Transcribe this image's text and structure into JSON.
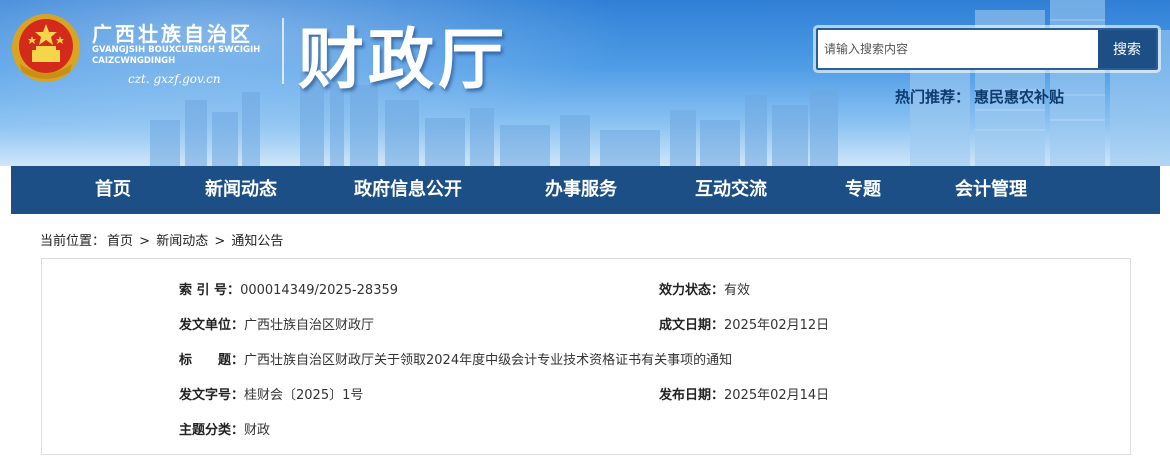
{
  "header": {
    "region_name": "广西壮族自治区",
    "region_name_zh": "GVANGJSIH BOUXCUENGH SWCIGIH CAIZCWNGDINGH",
    "domain": "czt. gxzf.gov.cn",
    "dept_title": "财政厅"
  },
  "search": {
    "placeholder": "请输入搜索内容",
    "button_label": "搜索",
    "hot_label": "热门推荐：",
    "hot_item": "惠民惠农补贴"
  },
  "nav": {
    "items": [
      "首页",
      "新闻动态",
      "政府信息公开",
      "办事服务",
      "互动交流",
      "专题",
      "会计管理"
    ]
  },
  "breadcrumb": {
    "prefix": "当前位置：",
    "items": [
      "首页",
      "新闻动态",
      "通知公告"
    ],
    "separator": ">"
  },
  "doc_info": {
    "index_label": "索 引 号：",
    "index_value": "000014349/2025-28359",
    "status_label": "效力状态：",
    "status_value": "有效",
    "issuer_label": "发文单位：",
    "issuer_value": "广西壮族自治区财政厅",
    "date_label": "成文日期：",
    "date_value": "2025年02月12日",
    "title_label": "标　　题：",
    "title_value": "广西壮族自治区财政厅关于领取2024年度中级会计专业技术资格证书有关事项的通知",
    "docnum_label": "发文字号：",
    "docnum_value": "桂财会〔2025〕1号",
    "publish_label": "发布日期：",
    "publish_value": "2025年02月14日",
    "topic_label": "主题分类：",
    "topic_value": "财政"
  },
  "colors": {
    "nav_bg": "#1b4f86",
    "search_button": "#1d4f86",
    "hot_text": "#0f3a70"
  }
}
